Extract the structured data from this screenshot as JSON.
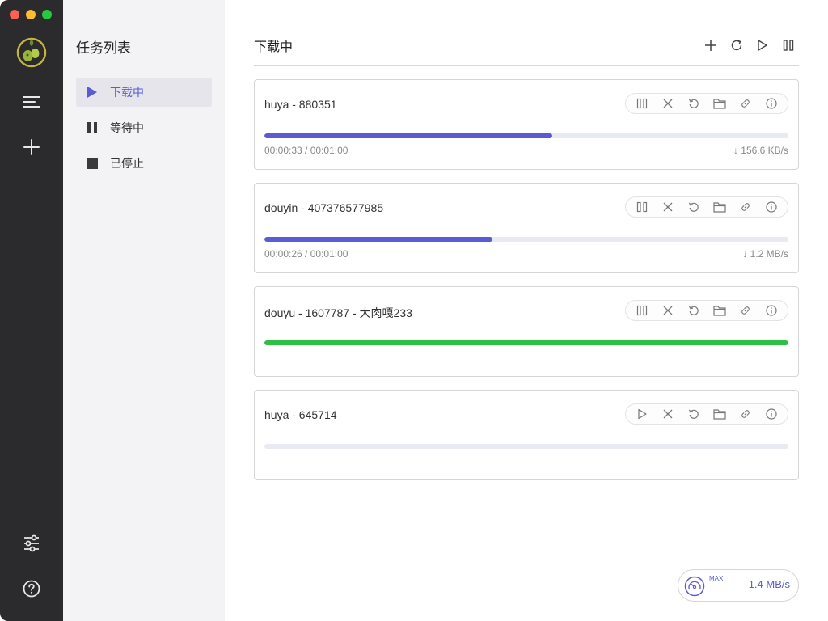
{
  "sidebar": {
    "title": "任务列表",
    "items": [
      {
        "label": "下载中",
        "icon": "play-icon",
        "active": true
      },
      {
        "label": "等待中",
        "icon": "pause-icon",
        "active": false
      },
      {
        "label": "已停止",
        "icon": "stop-icon",
        "active": false
      }
    ]
  },
  "main": {
    "title": "下载中",
    "header_actions": [
      "add-icon",
      "refresh-icon",
      "play-icon",
      "pause-icon"
    ]
  },
  "tasks": [
    {
      "name": "huya - 880351",
      "progress": 0.55,
      "time": "00:00:33 / 00:01:00",
      "speed": "↓ 156.6 KB/s",
      "status": "downloading"
    },
    {
      "name": "douyin - 407376577985",
      "progress": 0.435,
      "time": "00:00:26 / 00:01:00",
      "speed": "↓ 1.2 MB/s",
      "status": "downloading"
    },
    {
      "name": "douyu - 1607787 - 大肉嘎233",
      "progress": 1.0,
      "time": "",
      "speed": "",
      "status": "complete"
    },
    {
      "name": "huya - 645714",
      "progress": 0,
      "time": "",
      "speed": "",
      "status": "paused"
    }
  ],
  "speed_widget": {
    "label": "MAX",
    "value": "1.4 MB/s"
  },
  "colors": {
    "accent": "#5b5bd6",
    "complete": "#2ebf45",
    "rail": "#2b2b2d",
    "sidebar": "#f3f3f5"
  }
}
